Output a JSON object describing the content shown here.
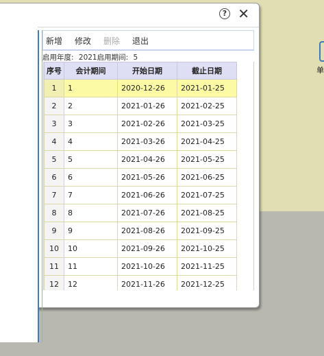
{
  "toolbar": {
    "add": "新增",
    "edit": "修改",
    "delete": "删除",
    "exit": "退出"
  },
  "info": {
    "year_label": "启用年度:",
    "year_value": "2021",
    "period_label": "启用期间:",
    "period_value": "5"
  },
  "table": {
    "headers": [
      "序号",
      "会计期间",
      "开始日期",
      "截止日期"
    ],
    "rows": [
      [
        "1",
        "1",
        "2020-12-26",
        "2021-01-25"
      ],
      [
        "2",
        "2",
        "2021-01-26",
        "2021-02-25"
      ],
      [
        "3",
        "3",
        "2021-02-26",
        "2021-03-25"
      ],
      [
        "4",
        "4",
        "2021-03-26",
        "2021-04-25"
      ],
      [
        "5",
        "5",
        "2021-04-26",
        "2021-05-25"
      ],
      [
        "6",
        "6",
        "2021-05-26",
        "2021-06-25"
      ],
      [
        "7",
        "7",
        "2021-06-26",
        "2021-07-25"
      ],
      [
        "8",
        "8",
        "2021-07-26",
        "2021-08-25"
      ],
      [
        "9",
        "9",
        "2021-08-26",
        "2021-09-25"
      ],
      [
        "10",
        "10",
        "2021-09-26",
        "2021-10-25"
      ],
      [
        "11",
        "11",
        "2021-10-26",
        "2021-11-25"
      ],
      [
        "12",
        "12",
        "2021-11-26",
        "2021-12-25"
      ]
    ]
  },
  "background": {
    "edge_label": "单"
  },
  "colors": {
    "header_bg": "#dedef4",
    "selected_row": "#fdfaa6",
    "splitter": "#4a78b6",
    "desktop": "#e0deb2"
  },
  "icons": {
    "help": "question-circle-icon",
    "close": "close-icon"
  },
  "help_glyph": "?",
  "close_glyph": "✕"
}
